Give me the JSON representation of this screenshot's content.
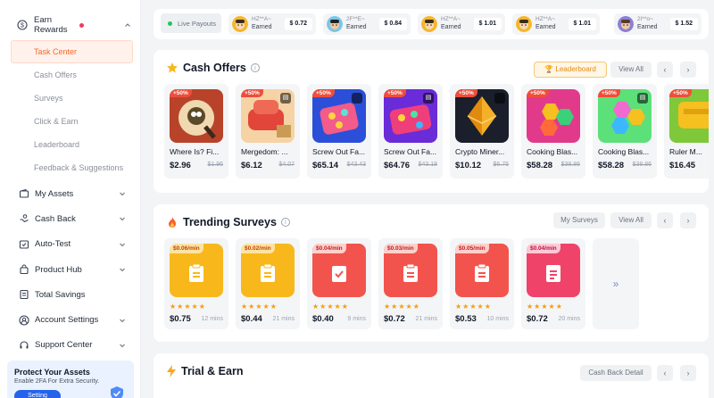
{
  "sidebar": {
    "earn_rewards": "Earn Rewards",
    "sub_items": [
      "Task Center",
      "Cash Offers",
      "Surveys",
      "Click & Earn",
      "Leaderboard",
      "Feedback & Suggestions"
    ],
    "nav_items": [
      {
        "label": "My Assets",
        "icon": "wallet-icon"
      },
      {
        "label": "Cash Back",
        "icon": "cash-icon"
      },
      {
        "label": "Auto-Test",
        "icon": "test-icon"
      },
      {
        "label": "Product Hub",
        "icon": "bag-icon"
      },
      {
        "label": "Total Savings",
        "icon": "savings-icon"
      },
      {
        "label": "Account Settings",
        "icon": "user-icon"
      },
      {
        "label": "Support Center",
        "icon": "headset-icon"
      }
    ],
    "protect": {
      "title": "Protect Your Assets",
      "desc": "Enable 2FA For Extra Security.",
      "button": "Setting"
    }
  },
  "payouts": {
    "live_label": "Live Payouts",
    "items": [
      {
        "name": "HZ**A~",
        "earned": "Earned",
        "amount": "$ 0.72"
      },
      {
        "name": "2F**E~",
        "earned": "Earned",
        "amount": "$ 0.84"
      },
      {
        "name": "HZ**A~",
        "earned": "Earned",
        "amount": "$ 1.01"
      },
      {
        "name": "HZ**A~",
        "earned": "Earned",
        "amount": "$ 1.01"
      },
      {
        "name": "2I**o~",
        "earned": "Earned",
        "amount": "$ 1.52"
      }
    ]
  },
  "cash_offers": {
    "title": "Cash Offers",
    "leaderboard": "Leaderboard",
    "view_all": "View All",
    "items": [
      {
        "bonus": "+50%",
        "name": "Where Is? Fi...",
        "price": "$2.96",
        "old": "$1.96"
      },
      {
        "bonus": "+50%",
        "name": "Mergedom: ...",
        "price": "$6.12",
        "old": "$4.07"
      },
      {
        "bonus": "+50%",
        "name": "Screw Out Fa...",
        "price": "$65.14",
        "old": "$43.43"
      },
      {
        "bonus": "+50%",
        "name": "Screw Out Fa...",
        "price": "$64.76",
        "old": "$43.18"
      },
      {
        "bonus": "+50%",
        "name": "Crypto Miner...",
        "price": "$10.12",
        "old": "$6.75"
      },
      {
        "bonus": "+50%",
        "name": "Cooking Blas...",
        "price": "$58.28",
        "old": "$38.86"
      },
      {
        "bonus": "+50%",
        "name": "Cooking Blas...",
        "price": "$58.28",
        "old": "$38.86"
      },
      {
        "bonus": "+50%",
        "name": "Ruler M...",
        "price": "$16.45",
        "old": ""
      }
    ]
  },
  "surveys": {
    "title": "Trending Surveys",
    "my_surveys": "My Surveys",
    "view_all": "View All",
    "more": "»",
    "items": [
      {
        "rate": "$0.06/min",
        "price": "$0.75",
        "mins": "12 mins",
        "color": "#f8b81c"
      },
      {
        "rate": "$0.02/min",
        "price": "$0.44",
        "mins": "21 mins",
        "color": "#f8b81c"
      },
      {
        "rate": "$0.04/min",
        "price": "$0.40",
        "mins": "9 mins",
        "color": "#f2544d"
      },
      {
        "rate": "$0.03/min",
        "price": "$0.72",
        "mins": "21 mins",
        "color": "#f2544d"
      },
      {
        "rate": "$0.05/min",
        "price": "$0.53",
        "mins": "10 mins",
        "color": "#f2544d"
      },
      {
        "rate": "$0.04/min",
        "price": "$0.72",
        "mins": "20 mins",
        "color": "#f0436a"
      }
    ]
  },
  "trial": {
    "title": "Trial & Earn",
    "cash_back_detail": "Cash Back Detail"
  },
  "stars": "★★★★★",
  "arrow_left": "‹",
  "arrow_right": "›"
}
